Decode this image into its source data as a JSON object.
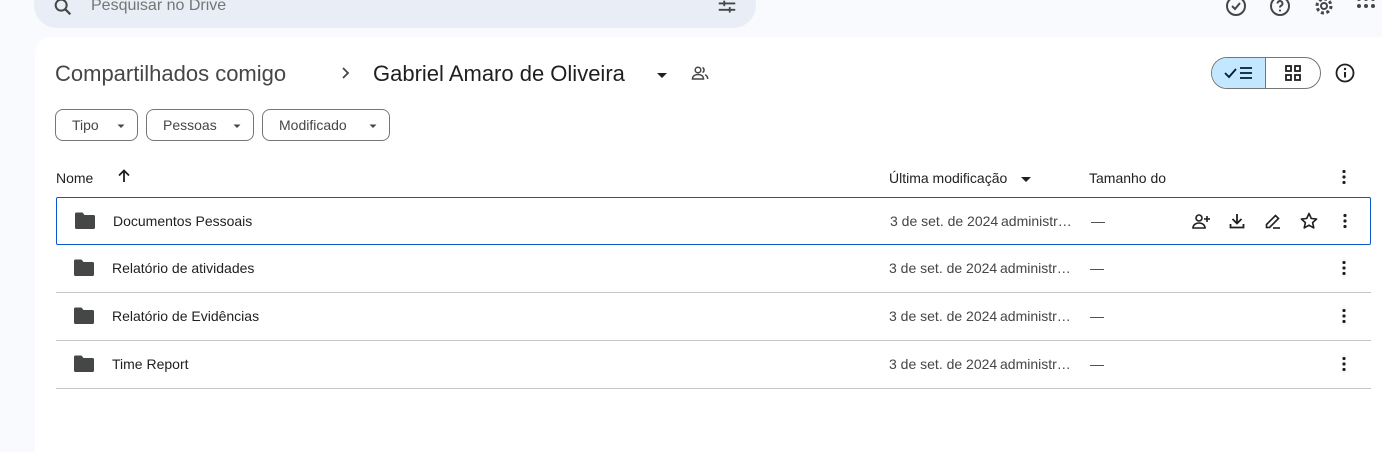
{
  "search": {
    "placeholder": "Pesquisar no Drive"
  },
  "header": {
    "breadcrumb_root": "Compartilhados comigo",
    "breadcrumb_current": "Gabriel Amaro de Oliveira"
  },
  "filters": [
    {
      "label": "Tipo"
    },
    {
      "label": "Pessoas"
    },
    {
      "label": "Modificado"
    }
  ],
  "table": {
    "columns": {
      "name": "Nome",
      "modified": "Última modificação",
      "size": "Tamanho do"
    },
    "rows": [
      {
        "name": "Documentos Pessoais",
        "date": "3 de set. de 2024",
        "owner": "administrador",
        "size": "—"
      },
      {
        "name": "Relatório de atividades",
        "date": "3 de set. de 2024",
        "owner": "administrador",
        "size": "—"
      },
      {
        "name": "Relatório de Evidências",
        "date": "3 de set. de 2024",
        "owner": "administrador",
        "size": "—"
      },
      {
        "name": "Time Report",
        "date": "3 de set. de 2024",
        "owner": "administrador",
        "size": "—"
      }
    ]
  },
  "icons": {
    "top_right": [
      "ready-for-offline-icon",
      "help-icon",
      "settings-icon",
      "apps-icon"
    ],
    "row_actions": [
      "share-icon",
      "download-icon",
      "rename-icon",
      "star-icon"
    ]
  },
  "colors": {
    "accent": "#0b57d0",
    "toggle_selected": "#c2e7ff",
    "search_bg": "#e9eef6"
  }
}
